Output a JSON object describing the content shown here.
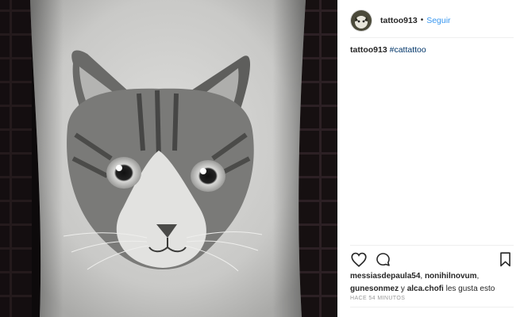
{
  "post": {
    "username": "tattoo913",
    "separator": "•",
    "follow_label": "Seguir",
    "caption": {
      "username": "tattoo913",
      "hashtag": "#cattattoo"
    },
    "likes": {
      "users": [
        "messiasdepaula54",
        "nonihilnovum",
        "gunesonmez",
        "alca.chofi"
      ],
      "sep1": ", ",
      "sep2": ", ",
      "sep3": " y ",
      "suffix": " les gusta esto"
    },
    "timestamp": "HACE 54 MINUTOS",
    "icons": {
      "like": "heart-icon",
      "comment": "comment-icon",
      "save": "bookmark-icon"
    }
  },
  "colors": {
    "link": "#3897f0",
    "hashtag": "#003569",
    "photo_background": "#0d0a0b",
    "divider": "#efefef"
  }
}
